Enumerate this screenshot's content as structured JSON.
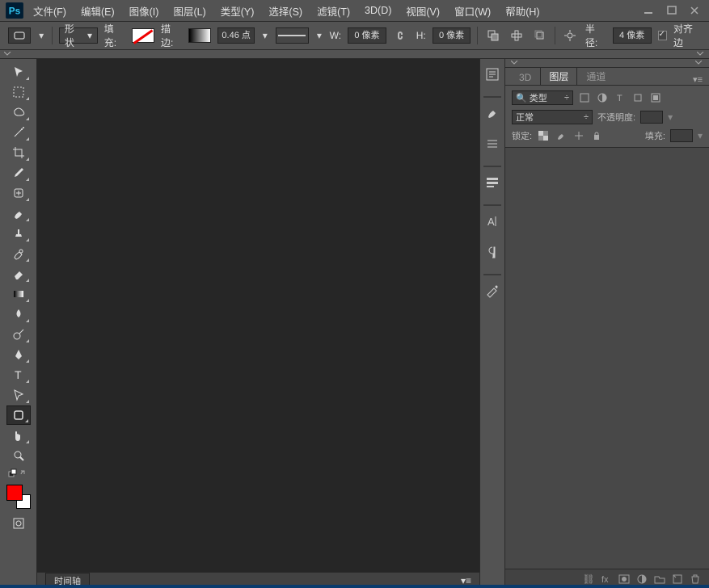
{
  "app": {
    "name": "Ps"
  },
  "menu": [
    "文件(F)",
    "编辑(E)",
    "图像(I)",
    "图层(L)",
    "类型(Y)",
    "选择(S)",
    "滤镜(T)",
    "3D(D)",
    "视图(V)",
    "窗口(W)",
    "帮助(H)"
  ],
  "optionsBar": {
    "shapeModeLabel": "形状",
    "fillLabel": "填充:",
    "strokeLabel": "描边:",
    "strokeWidth": "0.46 点",
    "widthLabel": "W:",
    "widthValue": "0 像素",
    "heightLabel": "H:",
    "heightValue": "0 像素",
    "radiusLabel": "半径:",
    "radiusValue": "4 像素",
    "alignLabel": "对齐边"
  },
  "tools": [
    {
      "name": "move-tool"
    },
    {
      "name": "marquee-tool"
    },
    {
      "name": "lasso-tool"
    },
    {
      "name": "magic-wand-tool"
    },
    {
      "name": "crop-tool"
    },
    {
      "name": "eyedropper-tool"
    },
    {
      "name": "healing-brush-tool"
    },
    {
      "name": "brush-tool"
    },
    {
      "name": "clone-stamp-tool"
    },
    {
      "name": "history-brush-tool"
    },
    {
      "name": "eraser-tool"
    },
    {
      "name": "gradient-tool"
    },
    {
      "name": "blur-tool"
    },
    {
      "name": "dodge-tool"
    },
    {
      "name": "pen-tool"
    },
    {
      "name": "type-tool"
    },
    {
      "name": "path-selection-tool"
    },
    {
      "name": "shape-tool"
    },
    {
      "name": "hand-tool"
    },
    {
      "name": "zoom-tool"
    }
  ],
  "bottomTab": "时间轴",
  "rightPanel": {
    "tabs": [
      "3D",
      "图层",
      "通道"
    ],
    "filterLabel": "类型",
    "blendMode": "正常",
    "opacityLabel": "不透明度:",
    "lockLabel": "锁定:",
    "fillLabel": "填充:"
  }
}
